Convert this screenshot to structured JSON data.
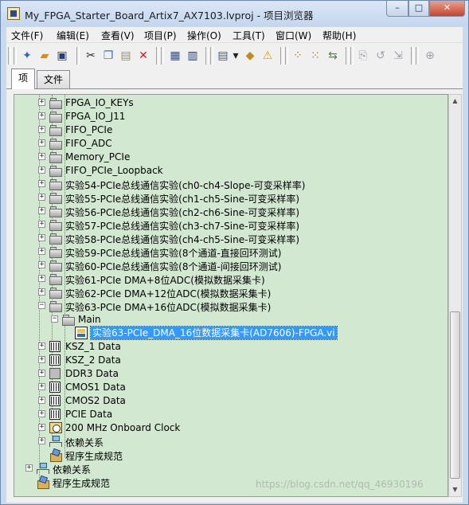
{
  "window": {
    "title": "My_FPGA_Starter_Board_Artix7_AX7103.lvproj - 项目浏览器",
    "buttons": {
      "minimize": "–",
      "maximize": "□",
      "close": "✕"
    }
  },
  "menubar": {
    "items": [
      {
        "label": "文件(F)"
      },
      {
        "label": "编辑(E)"
      },
      {
        "label": "查看(V)"
      },
      {
        "label": "项目(P)"
      },
      {
        "label": "操作(O)"
      },
      {
        "label": "工具(T)"
      },
      {
        "label": "窗口(W)"
      },
      {
        "label": "帮助(H)"
      }
    ]
  },
  "toolbar": {
    "icons": [
      {
        "name": "new-icon",
        "glyph": "✦",
        "color": "#2f67b8"
      },
      {
        "name": "open-icon",
        "glyph": "▰",
        "color": "#c9922e"
      },
      {
        "name": "save-all-icon",
        "glyph": "▣",
        "color": "#223f7a"
      },
      {
        "name": "cut-icon",
        "glyph": "✂",
        "color": "#2a2a2a"
      },
      {
        "name": "copy-icon",
        "glyph": "❐",
        "color": "#3b6fb5"
      },
      {
        "name": "paste-icon",
        "glyph": "▤",
        "color": "#b78b34"
      },
      {
        "name": "delete-icon",
        "glyph": "✕",
        "color": "#d21b1b"
      },
      {
        "name": "deploy-icon",
        "glyph": "▦",
        "color": "#1f4fa0"
      },
      {
        "name": "build-icon",
        "glyph": "▥",
        "color": "#1a3a78"
      },
      {
        "name": "view-icon",
        "glyph": "▤",
        "color": "#2a5da6"
      },
      {
        "name": "dropdown-arrow-icon",
        "glyph": "▾",
        "color": "#222222"
      },
      {
        "name": "resolve-icon",
        "glyph": "◆",
        "color": "#c28a1a"
      },
      {
        "name": "warning-icon",
        "glyph": "⚠",
        "color": "#d8a300"
      },
      {
        "name": "collapse-icon",
        "glyph": "⁘",
        "color": "#b07b22"
      },
      {
        "name": "expand-icon",
        "glyph": "⁙",
        "color": "#b07b22"
      },
      {
        "name": "sync-icon",
        "glyph": "⇆",
        "color": "#4d8a2c"
      },
      {
        "name": "check-out-icon",
        "glyph": "⎘",
        "color": "#9aa3ad"
      },
      {
        "name": "undo-icon",
        "glyph": "↺",
        "color": "#9aa3ad"
      },
      {
        "name": "check-in-icon",
        "glyph": "⇲",
        "color": "#9aa3ad"
      },
      {
        "name": "add-icon",
        "glyph": "⊕",
        "color": "#9aa3ad"
      }
    ]
  },
  "tabs": [
    {
      "label": "项",
      "active": true
    },
    {
      "label": "文件",
      "active": false
    }
  ],
  "tree": {
    "rows": [
      {
        "label": "FPGA_IO_KEYs",
        "icon": "folder",
        "expander": "+"
      },
      {
        "label": "FPGA_IO_J11",
        "icon": "folder",
        "expander": "+"
      },
      {
        "label": "FIFO_PCIe",
        "icon": "folder",
        "expander": "+"
      },
      {
        "label": "FIFO_ADC",
        "icon": "folder",
        "expander": "+"
      },
      {
        "label": "Memory_PCIe",
        "icon": "folder",
        "expander": "+"
      },
      {
        "label": "FIFO_PCIe_Loopback",
        "icon": "folder",
        "expander": "+"
      },
      {
        "label": "实验54-PCIe总线通信实验(ch0-ch4-Slope-可变采样率)",
        "icon": "folder",
        "expander": "+"
      },
      {
        "label": "实验55-PCIe总线通信实验(ch1-ch5-Sine-可变采样率)",
        "icon": "folder",
        "expander": "+"
      },
      {
        "label": "实验56-PCIe总线通信实验(ch2-ch6-Sine-可变采样率)",
        "icon": "folder",
        "expander": "+"
      },
      {
        "label": "实验57-PCIe总线通信实验(ch3-ch7-Sine-可变采样率)",
        "icon": "folder",
        "expander": "+"
      },
      {
        "label": "实验58-PCIe总线通信实验(ch4-ch5-Sine-可变采样率)",
        "icon": "folder",
        "expander": "+"
      },
      {
        "label": "实验59-PCIe总线通信实验(8个通道-直接回环测试)",
        "icon": "folder",
        "expander": "+"
      },
      {
        "label": "实验60-PCIe总线通信实验(8个通道-间接回环测试)",
        "icon": "folder",
        "expander": "+"
      },
      {
        "label": "实验61-PCIe DMA+8位ADC(模拟数据采集卡)",
        "icon": "folder",
        "expander": "+"
      },
      {
        "label": "实验62-PCIe DMA+12位ADC(模拟数据采集卡)",
        "icon": "folder",
        "expander": "+"
      },
      {
        "label": "实验63-PCIe DMA+16位ADC(模拟数据采集卡)",
        "icon": "folder",
        "expander": "−"
      },
      {
        "label": "Main",
        "icon": "folder",
        "expander": "−"
      },
      {
        "label": "实验63-PCIe_DMA_16位数据采集卡(AD7606)-FPGA.vi",
        "icon": "vi",
        "expander": "",
        "selected": true
      },
      {
        "label": "KSZ_1 Data",
        "icon": "chip",
        "expander": "+"
      },
      {
        "label": "KSZ_2 Data",
        "icon": "chip",
        "expander": "+"
      },
      {
        "label": "DDR3 Data",
        "icon": "chip-grey",
        "expander": "+"
      },
      {
        "label": "CMOS1 Data",
        "icon": "chip",
        "expander": "+"
      },
      {
        "label": "CMOS2 Data",
        "icon": "chip",
        "expander": "+"
      },
      {
        "label": "PCIE Data",
        "icon": "chip",
        "expander": "+"
      },
      {
        "label": "200 MHz Onboard Clock",
        "icon": "clock",
        "expander": "+"
      },
      {
        "label": "依赖关系",
        "icon": "deps",
        "expander": "+"
      },
      {
        "label": "程序生成规范",
        "icon": "build",
        "expander": ""
      },
      {
        "label": "依赖关系",
        "icon": "deps",
        "expander": "+"
      },
      {
        "label": "程序生成规范",
        "icon": "build",
        "expander": ""
      }
    ]
  },
  "watermark": "https://blog.csdn.net/qq_46930196"
}
